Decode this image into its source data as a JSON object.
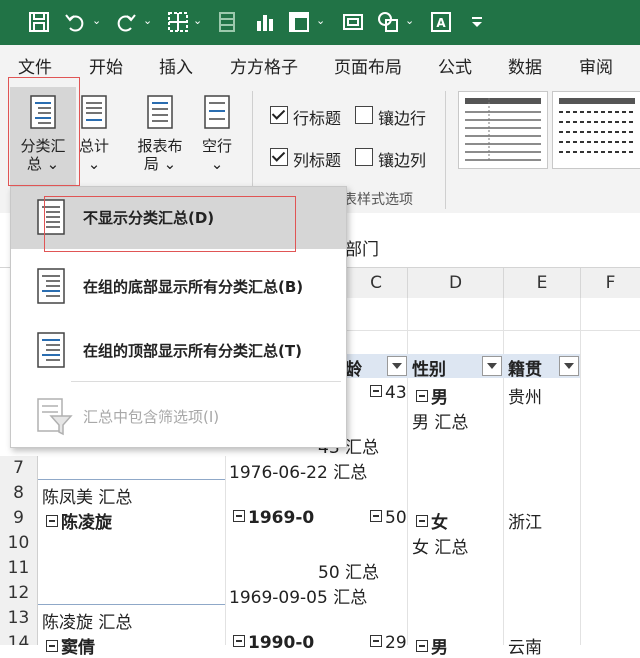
{
  "colors": {
    "accent": "#217346",
    "highlight": "#e05555",
    "header_fill": "#dde6f2"
  },
  "quick_access": [
    "save-icon",
    "undo-icon",
    "redo-icon",
    "borders-icon",
    "grid-icon",
    "chart-icon",
    "pivot-icon",
    "camera-icon",
    "shapes-icon",
    "text-icon",
    "customize-icon"
  ],
  "tabs": [
    "文件",
    "开始",
    "插入",
    "方方格子",
    "页面布局",
    "公式",
    "数据",
    "审阅"
  ],
  "ribbon": {
    "subtotal": {
      "line1": "分类汇",
      "line2": "总 ⌄"
    },
    "grand_total": {
      "line1": "总计",
      "line2": "⌄"
    },
    "report_layout": {
      "line1": "报表布",
      "line2": "局 ⌄"
    },
    "blank_rows": {
      "line1": "空行",
      "line2": "⌄"
    },
    "options": {
      "row_headers": "行标题",
      "col_headers": "列标题",
      "banded_rows": "镶边行",
      "banded_cols": "镶边列"
    },
    "group_label": "表样式选项"
  },
  "formula_bar": {
    "value": "部门"
  },
  "menu": {
    "items": [
      "不显示分类汇总(D)",
      "在组的底部显示所有分类汇总(B)",
      "在组的顶部显示所有分类汇总(T)",
      "汇总中包含筛选项(I)"
    ]
  },
  "columns": [
    "C",
    "D",
    "E",
    "F"
  ],
  "rows": [
    "7",
    "8",
    "9",
    "10",
    "11",
    "12",
    "13",
    "14"
  ],
  "table_header": {
    "age": "龄",
    "gender": "性别",
    "hometown": "籍贯"
  },
  "cells": {
    "r5_age": "43",
    "r5_gender": "男",
    "r5_home": "贵州",
    "r6_gender_total": "男 汇总",
    "r6_age_total": "43 汇总",
    "r7_date": "1976-06-22 汇总",
    "r8_name_total": "陈凤美 汇总",
    "r9_name": "陈凌旋",
    "r9_date": "1969-0",
    "r9_age": "50",
    "r9_gender": "女",
    "r9_home": "浙江",
    "r10_gender_total": "女 汇总",
    "r11_age_total": "50 汇总",
    "r12_date": "1969-09-05 汇总",
    "r13_name_total": "陈凌旋 汇总",
    "r14_name": "窦倩",
    "r14_date": "1990-0",
    "r14_age": "29",
    "r14_gender": "男",
    "r14_home": "云南"
  }
}
